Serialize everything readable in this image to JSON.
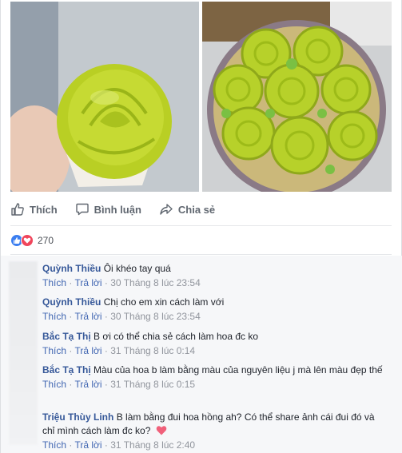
{
  "actions": {
    "like_label": "Thích",
    "comment_label": "Bình luận",
    "share_label": "Chia sẻ"
  },
  "reactions": {
    "count": "270",
    "types": [
      "like",
      "love"
    ]
  },
  "comments": [
    {
      "name": "Quỳnh Thiều",
      "text": "Ôi khéo tay quá",
      "like": "Thích",
      "reply": "Trả lời",
      "time": "30 Tháng 8 lúc 23:54"
    },
    {
      "name": "Quỳnh Thiều",
      "text": "Chị cho em xin cách làm với",
      "like": "Thích",
      "reply": "Trả lời",
      "time": "30 Tháng 8 lúc 23:54"
    },
    {
      "name": "Bắc Tạ Thị",
      "text": "B ơi có thể chia sẻ cách làm hoa đc ko",
      "like": "Thích",
      "reply": "Trả lời",
      "time": "31 Tháng 8 lúc 0:14"
    },
    {
      "name": "Bắc Tạ Thị",
      "text": "Màu của hoa b làm bằng màu của nguyên liệu j mà lên màu đẹp thế",
      "like": "Thích",
      "reply": "Trả lời",
      "time": "31 Tháng 8 lúc 0:15"
    },
    {
      "name": "Triệu Thùy Linh",
      "text": "B làm bằng đui hoa hồng ah? Có thể share ảnh cái đui đó và chỉ mình cách làm đc ko?",
      "like": "Thích",
      "reply": "Trả lời",
      "time": "31 Tháng 8 lúc 2:40"
    }
  ],
  "colors": {
    "link": "#365899",
    "meta_link": "#4267b2",
    "like_blue": "#3b7ef0",
    "love_red": "#f0455b",
    "flower_green": "#b5cf1f"
  }
}
